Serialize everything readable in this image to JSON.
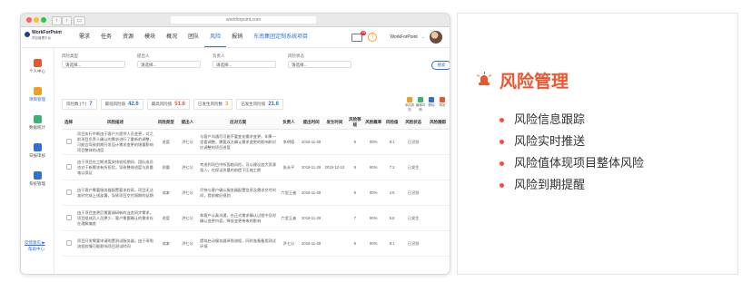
{
  "browser": {
    "url": "workforpoint.com"
  },
  "app": {
    "logo_title": "WorkForPoint",
    "logo_sub": "项目管理平台",
    "menu": [
      "需求",
      "任务",
      "资源",
      "模块",
      "概况",
      "团队",
      "风险",
      "报销"
    ],
    "active_menu": "风险",
    "project_selector": "东南集团定制系统项目",
    "mail_badge": "99",
    "username": "WorkForPoint"
  },
  "sidebar": [
    {
      "label": "个人中心",
      "color": "#e9572f"
    },
    {
      "label": "项目管理",
      "color": "#f0a020"
    },
    {
      "label": "数据统计",
      "color": "#3cb371"
    },
    {
      "label": "日报审核",
      "color": "#2f6fd6"
    },
    {
      "label": "系统管理",
      "color": "#2f6fd6"
    }
  ],
  "sidebar_links": {
    "feedback": "反馈意见 ▶",
    "help": "帮助中心"
  },
  "filters": [
    {
      "label": "风险类型",
      "value": "请选择..."
    },
    {
      "label": "提出人",
      "value": "请选择..."
    },
    {
      "label": "负责人",
      "value": "请选择..."
    },
    {
      "label": "风险状态",
      "value": "请选择..."
    }
  ],
  "search_label": "搜索",
  "stats": [
    {
      "label": "风险数 (个)",
      "value": "7",
      "color": "#2f6fd6"
    },
    {
      "label": "最低风险值",
      "value": "42.6",
      "color": "#2f6fd6"
    },
    {
      "label": "最高风险值",
      "value": "51.6",
      "color": "#e9572f"
    },
    {
      "label": "已发生风险数",
      "value": "3",
      "color": "#f0a020"
    },
    {
      "label": "已发生风险值",
      "value": "21.6",
      "color": "#2f6fd6"
    }
  ],
  "tools": [
    {
      "label": "添加风险",
      "color": "#f0a020"
    },
    {
      "label": "编辑详情",
      "color": "#3cb371"
    },
    {
      "label": "删除",
      "color": "#2f6fd6"
    },
    {
      "label": "禁用",
      "color": "#e9572f"
    }
  ],
  "table": {
    "headers": [
      "选择",
      "风险描述",
      "风险类型",
      "提出人",
      "应对方案",
      "负责人",
      "提出时间",
      "发生时间",
      "风险等级",
      "风险概率",
      "风险值",
      "风险状态",
      "风险跟踪"
    ],
    "rows": [
      [
        "",
        "项目执行中断由于客户方提供人员变更，对之前项目负责人确认的需求进行了重新的调整，可能会导致前期开发设计需求变更的增量影响项目整体的进度",
        "进度",
        "洪七公",
        "与客户沟通尽可能不要变化需求变更。如果一定要调整，需要双方确认需求变更的影响和对应调整的项目进度",
        "李明德",
        "2019-11-29",
        "",
        "9",
        "80%",
        "8.1",
        "已识别",
        ""
      ],
      [
        "",
        "由于项目在工期进度安排较短期间，团队成员也对于新需求有所担忧，导致整体进度与质量难以保证",
        "质量",
        "洪七公",
        "考虑到项目中所面临风险，可以建议加大资源投入，在保证质量的前提下压缩工期",
        "张永平",
        "2019-11-29",
        "2019-12-10",
        "9",
        "80%",
        "7.2",
        "已发生",
        ""
      ],
      [
        "",
        "由于客户需要服务器配置要求较高，项目无法准时完成上线部署，导致项目交付周期的延期",
        "成本",
        "洪七公",
        "尽快与客户确认服务器配置信息及需求交付时间，提前做好规划",
        "六里王者",
        "2019-11-29",
        "",
        "9",
        "60%",
        "4.8",
        "已识别",
        ""
      ],
      [
        "",
        "由于项目变更后需要调研新的业务同步需求，项目组成员人员更少，客户需要确认的需求存在理解偏差",
        "进度",
        "洪七公",
        "和客户认真沟通，在正式需求确认过程中及时确认变更内容，降低变更带来的影响",
        "六里王者",
        "2019-11-29",
        "",
        "7",
        "80%",
        "5.6",
        "已发生",
        ""
      ],
      [
        "",
        "项目开发需要申请购置测试服务器，由于采购流程较慢可能影响项目测试时间",
        "成本",
        "洪七公",
        "提前启动服务器采购流程，同时准备备用测试环境",
        "洪七公",
        "2019-11-29",
        "",
        "9",
        "90%",
        "8.1",
        "已识别",
        ""
      ]
    ]
  },
  "panel": {
    "title": "风险管理",
    "bullets": [
      "风险信息跟踪",
      "风险实时推送",
      "风险值体现项目整体风险",
      "风险到期提醒"
    ]
  }
}
